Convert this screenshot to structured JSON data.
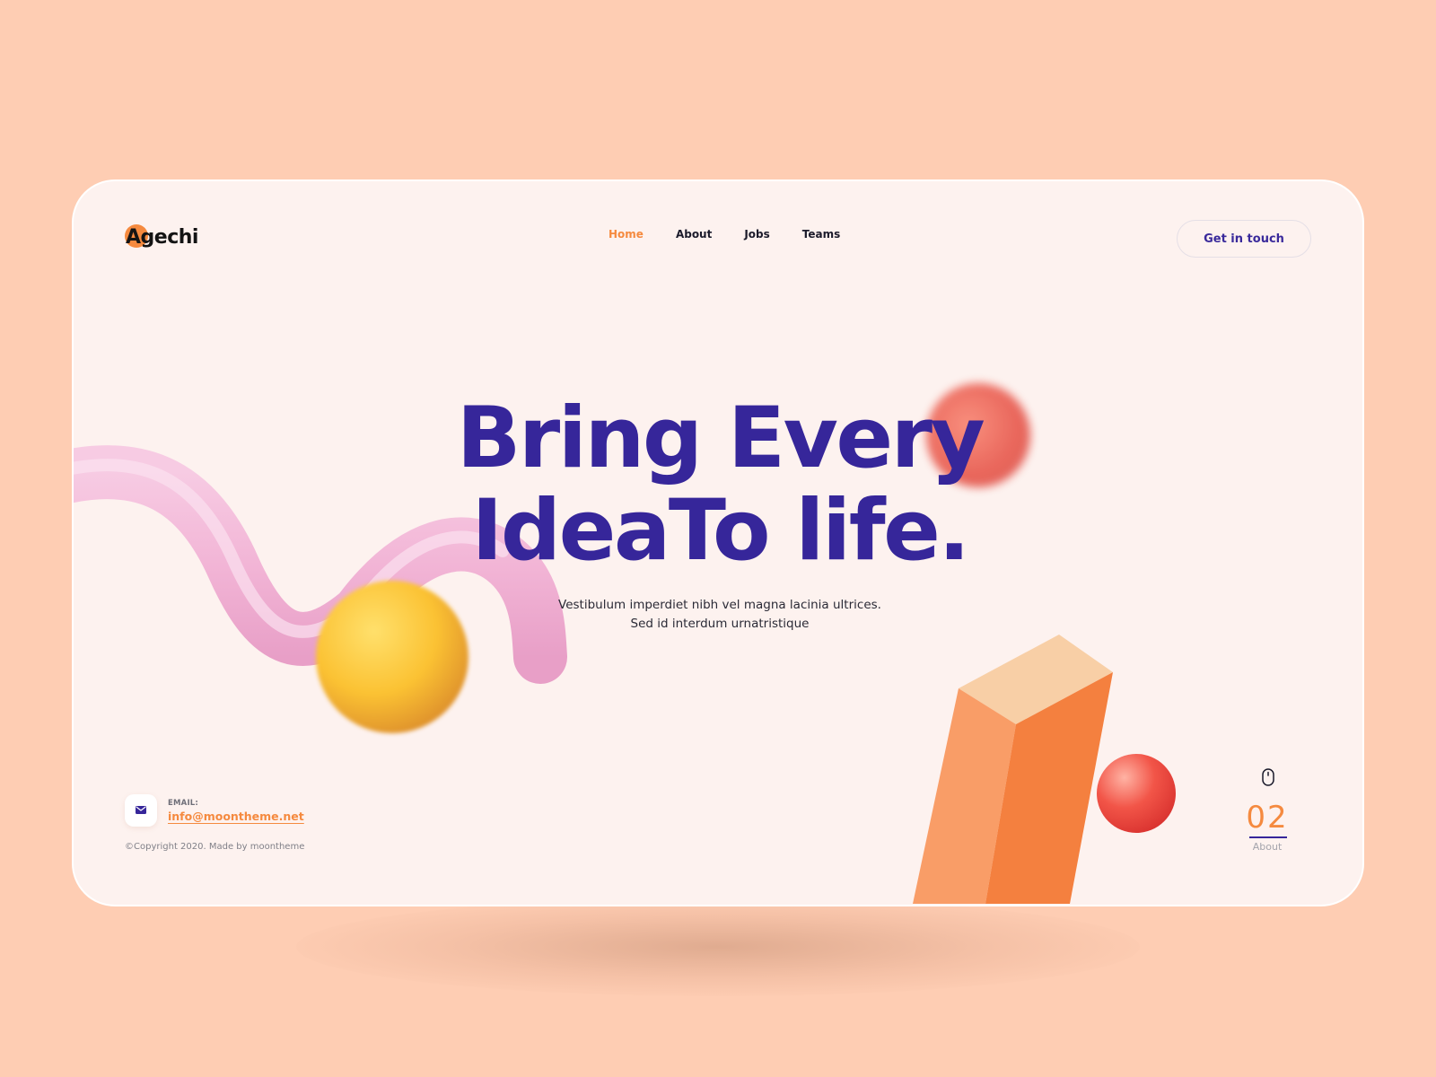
{
  "brand": {
    "name": "Agechi"
  },
  "nav": {
    "items": [
      {
        "label": "Home",
        "active": true
      },
      {
        "label": "About",
        "active": false
      },
      {
        "label": "Jobs",
        "active": false
      },
      {
        "label": "Teams",
        "active": false
      }
    ]
  },
  "header": {
    "cta_label": "Get in touch"
  },
  "hero": {
    "title_line1": "Bring Every",
    "title_line2": "IdeaTo life.",
    "subtitle_line1": "Vestibulum imperdiet nibh vel magna lacinia ultrices.",
    "subtitle_line2": "Sed id interdum urnatristique"
  },
  "contact": {
    "label": "EMAIL:",
    "email": "info@moontheme.net",
    "icon": "mail-icon"
  },
  "footer": {
    "copyright": "©Copyright 2020. Made by moontheme"
  },
  "pager": {
    "current": "02",
    "label": "About",
    "icon": "mouse-icon"
  },
  "colors": {
    "background": "#fecdb3",
    "card": "#fdf2ef",
    "primary": "#36269a",
    "accent": "#f58a3f",
    "text": "#1b1b2b"
  }
}
